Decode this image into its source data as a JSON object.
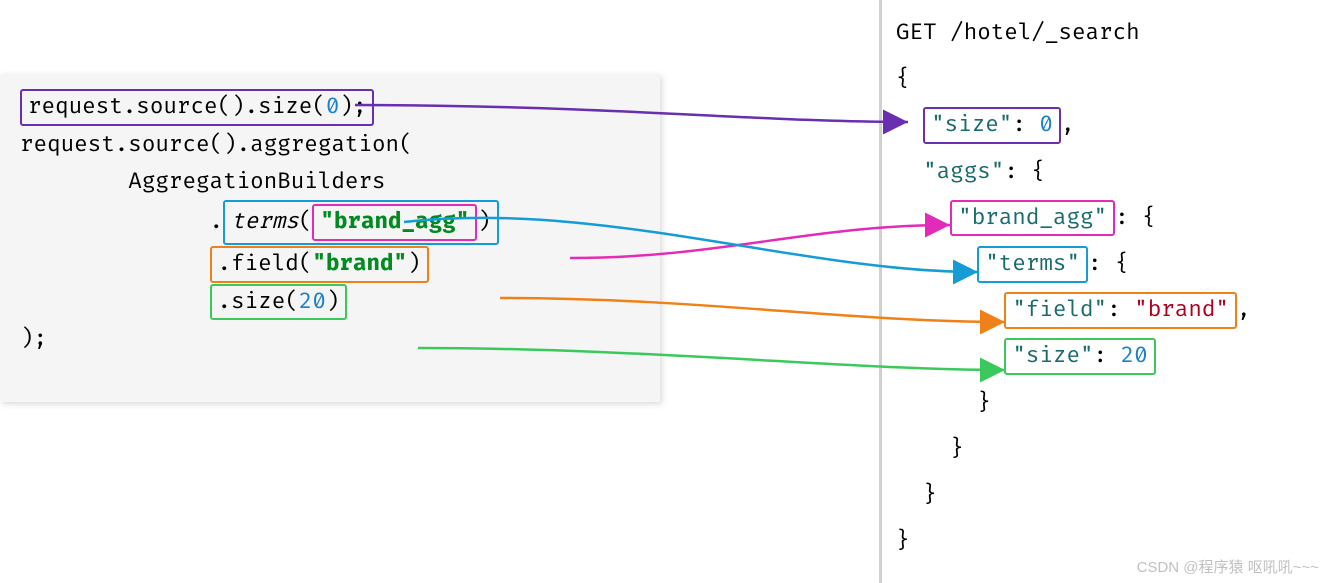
{
  "left": {
    "line1": "request.source().size(",
    "line1_zero": "0",
    "line1_end": ");",
    "line2": "request.source().aggregation(",
    "line3": "        AggregationBuilders",
    "terms_prefix": "              .",
    "terms_method": "terms",
    "terms_open": "(",
    "terms_arg": "\"brand_agg\"",
    "terms_close": ")",
    "field_prefix": "              ",
    "field_call": ".field(",
    "field_arg": "\"brand\"",
    "field_close": ")",
    "size_prefix": "              ",
    "size_call": ".size(",
    "size_arg": "20",
    "size_close": ")",
    "line_end": ");"
  },
  "right": {
    "get": "GET /hotel/_search",
    "o1": "{",
    "size_key": "\"size\"",
    "size_sep": ": ",
    "size_val": "0",
    "size_comma": ",",
    "aggs_key": "\"aggs\"",
    "aggs_rest": ": {",
    "brand_key": "\"brand_agg\"",
    "brand_rest": ": {",
    "terms_key": "\"terms\"",
    "terms_rest": ": {",
    "field_key": "\"field\"",
    "field_sep": ": ",
    "field_val": "\"brand\"",
    "field_comma": ",",
    "sz_key": "\"size\"",
    "sz_sep": ": ",
    "sz_val": "20",
    "c1": "      }",
    "c2": "    }",
    "c3": "  }",
    "c4": "}"
  },
  "watermark": "CSDN @程序猿 呕吼吼~~~",
  "colors": {
    "purple": "#6a2fb0",
    "magenta": "#e22bb8",
    "cyan": "#159bd6",
    "orange": "#f08018",
    "green": "#3bc95d"
  }
}
